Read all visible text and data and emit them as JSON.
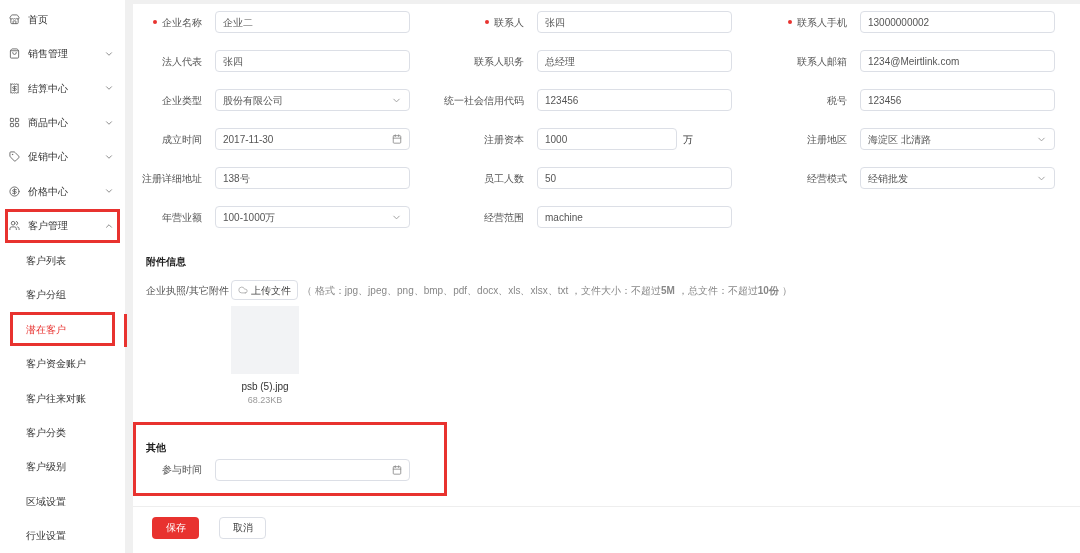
{
  "sidebar": {
    "items": [
      {
        "label": "首页",
        "highlighted": false
      },
      {
        "label": "销售管理",
        "expanded": false,
        "highlighted": false
      },
      {
        "label": "结算中心",
        "expanded": false,
        "highlighted": false
      },
      {
        "label": "商品中心",
        "expanded": false,
        "highlighted": false
      },
      {
        "label": "促销中心",
        "expanded": false,
        "highlighted": false
      },
      {
        "label": "价格中心",
        "expanded": false,
        "highlighted": false
      },
      {
        "label": "客户管理",
        "expanded": true,
        "highlighted": true,
        "children": [
          {
            "label": "客户列表",
            "selected": false,
            "highlighted": false
          },
          {
            "label": "客户分组",
            "selected": false,
            "highlighted": false
          },
          {
            "label": "潜在客户",
            "selected": true,
            "highlighted": true
          },
          {
            "label": "客户资金账户",
            "selected": false,
            "highlighted": false
          },
          {
            "label": "客户往来对账",
            "selected": false,
            "highlighted": false
          },
          {
            "label": "客户分类",
            "selected": false,
            "highlighted": false
          },
          {
            "label": "客户级别",
            "selected": false,
            "highlighted": false
          },
          {
            "label": "区域设置",
            "selected": false,
            "highlighted": false
          },
          {
            "label": "行业设置",
            "selected": false,
            "highlighted": false
          }
        ]
      }
    ]
  },
  "form": {
    "fields": [
      {
        "label": "企业名称",
        "value": "企业二",
        "kind": "text",
        "required": true
      },
      {
        "label": "联系人",
        "value": "张四",
        "kind": "text",
        "required": true
      },
      {
        "label": "联系人手机",
        "value": "13000000002",
        "kind": "text",
        "required": true
      },
      {
        "label": "法人代表",
        "value": "张四",
        "kind": "text",
        "required": false
      },
      {
        "label": "联系人职务",
        "value": "总经理",
        "kind": "text",
        "required": false
      },
      {
        "label": "联系人邮箱",
        "value": "1234@Meirtlink.com",
        "kind": "text",
        "required": false
      },
      {
        "label": "企业类型",
        "value": "股份有限公司",
        "kind": "select",
        "required": false
      },
      {
        "label": "统一社会信用代码",
        "value": "123456",
        "kind": "text",
        "required": false
      },
      {
        "label": "税号",
        "value": "123456",
        "kind": "text",
        "required": false
      },
      {
        "label": "成立时间",
        "value": "2017-11-30",
        "kind": "date",
        "required": false
      },
      {
        "label": "注册资本",
        "value": "1000",
        "kind": "text",
        "required": false,
        "suffix": "万"
      },
      {
        "label": "注册地区",
        "value": "海淀区 北清路",
        "kind": "select",
        "required": false
      },
      {
        "label": "注册详细地址",
        "value": "138号",
        "kind": "text",
        "required": false
      },
      {
        "label": "员工人数",
        "value": "50",
        "kind": "text",
        "required": false
      },
      {
        "label": "经营模式",
        "value": "经销批发",
        "kind": "select",
        "required": false
      },
      {
        "label": "年营业额",
        "value": "100-1000万",
        "kind": "select",
        "required": false
      },
      {
        "label": "经营范围",
        "value": "machine",
        "kind": "text",
        "required": false
      }
    ]
  },
  "attachments": {
    "title": "附件信息",
    "label": "企业执照/其它附件",
    "upload_button": "上传文件",
    "hint": "（ 格式：jpg、jpeg、png、bmp、pdf、docx、xls、xlsx、txt ，文件大小：不超过**5M** ，总文件：不超过**10份** ）",
    "files": [
      {
        "name": "psb (5).jpg",
        "size": "68.23KB"
      }
    ]
  },
  "other": {
    "title": "其他",
    "highlighted": true,
    "fields": [
      {
        "label": "参与时间",
        "kind": "date"
      }
    ]
  },
  "buttons": {
    "save": "保存",
    "cancel": "取消"
  }
}
